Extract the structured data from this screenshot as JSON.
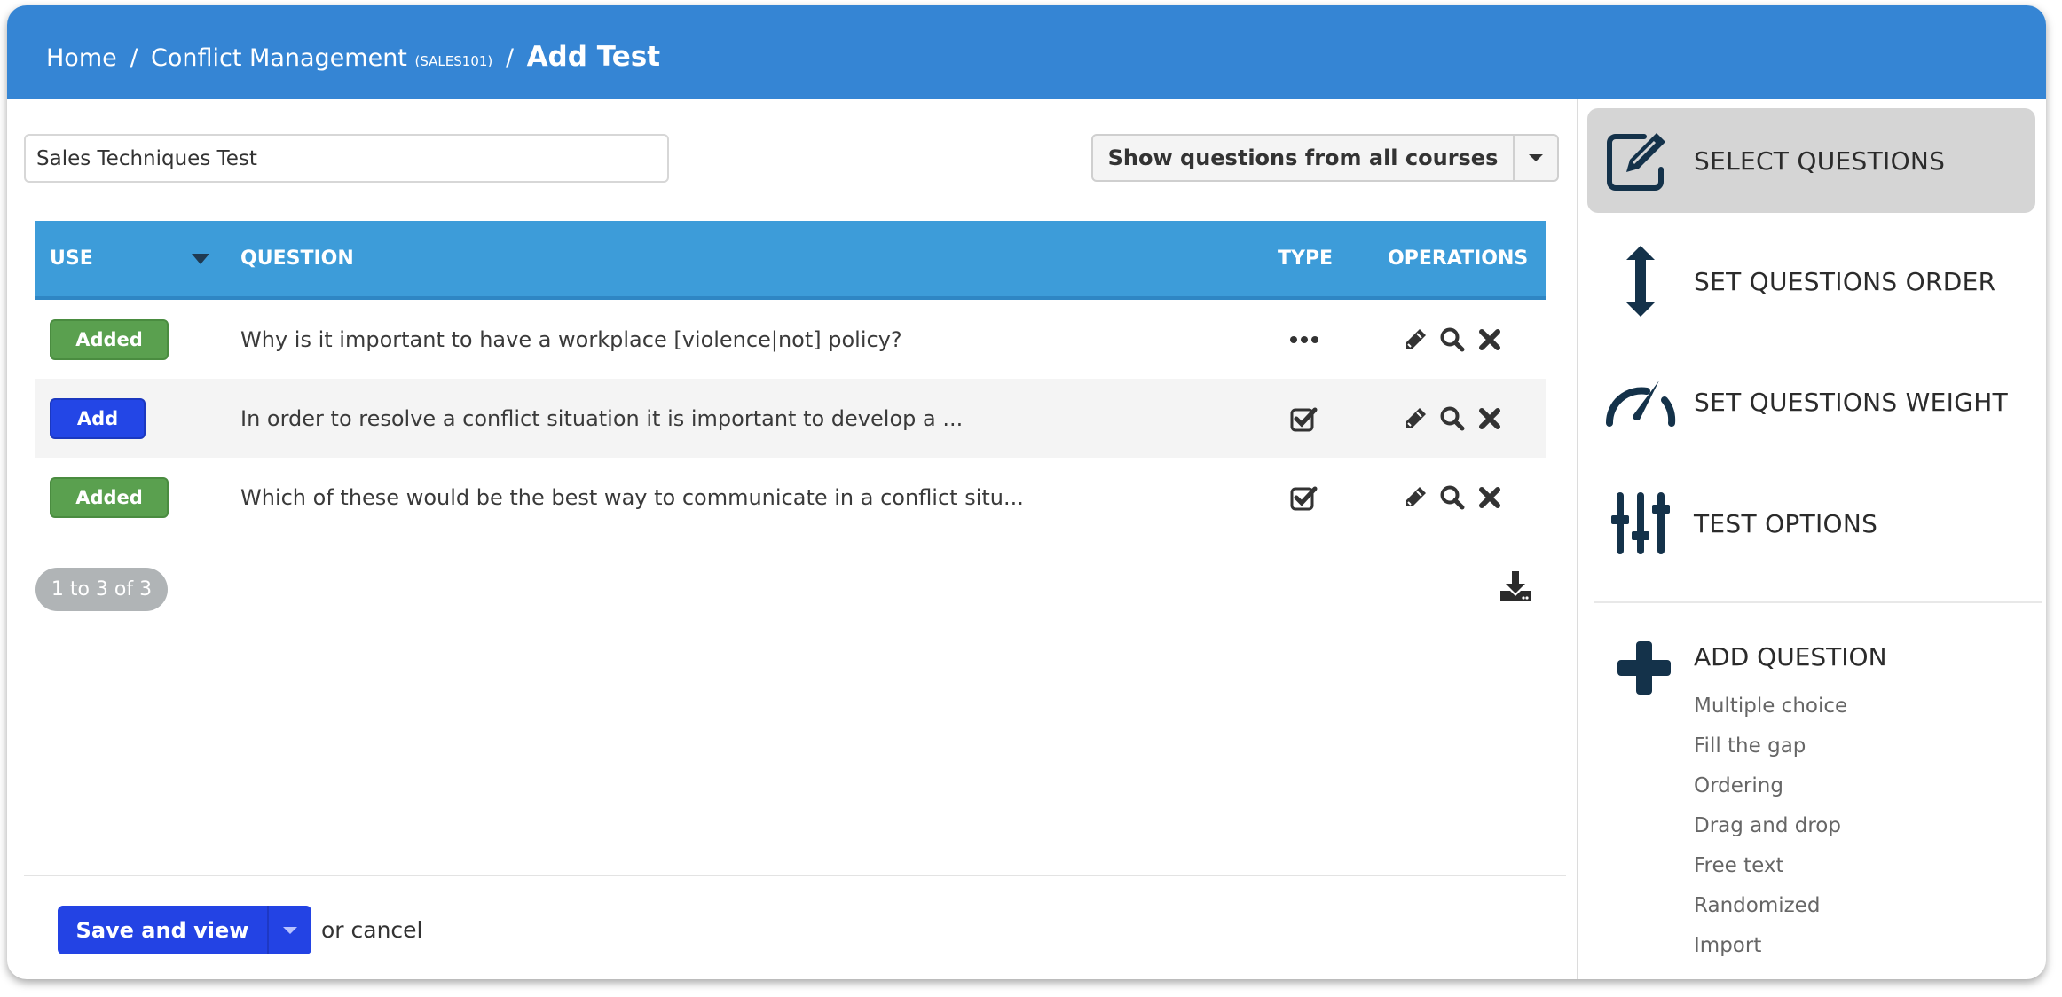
{
  "header": {
    "breadcrumb": {
      "home": "Home",
      "separator": "/",
      "course": "Conflict Management",
      "course_code": "(SALES101)",
      "current": "Add Test"
    }
  },
  "form": {
    "test_name_value": "Sales Techniques Test",
    "course_filter_label": "Show questions from all courses"
  },
  "table": {
    "columns": {
      "use": "USE",
      "question": "QUESTION",
      "type": "TYPE",
      "operations": "OPERATIONS"
    },
    "rows": [
      {
        "status": "Added",
        "question": "Why is it important to have a workplace [violence|not] policy?",
        "type_icon": "ellipsis-icon"
      },
      {
        "status": "Add",
        "question": "In order to resolve a conflict situation it is important to develop a ...",
        "type_icon": "checkbox-icon"
      },
      {
        "status": "Added",
        "question": "Which of these would be the best way to communicate in a conflict situ...",
        "type_icon": "checkbox-icon"
      }
    ],
    "operations_icons": [
      "pencil-icon",
      "search-icon",
      "close-icon"
    ],
    "pager": "1 to 3 of 3",
    "download_icon": "download-icon"
  },
  "footer": {
    "save_label": "Save and view",
    "cancel_text": "or cancel"
  },
  "sidebar": {
    "items": [
      {
        "label": "SELECT QUESTIONS",
        "icon": "edit-icon",
        "active": true
      },
      {
        "label": "SET QUESTIONS ORDER",
        "icon": "vertical-arrows-icon",
        "active": false
      },
      {
        "label": "SET QUESTIONS WEIGHT",
        "icon": "gauge-icon",
        "active": false
      },
      {
        "label": "TEST OPTIONS",
        "icon": "sliders-icon",
        "active": false
      }
    ],
    "add_question": {
      "title": "ADD QUESTION",
      "icon": "plus-icon",
      "types": [
        "Multiple choice",
        "Fill the gap",
        "Ordering",
        "Drag and drop",
        "Free text",
        "Randomized",
        "Import"
      ]
    }
  },
  "colors": {
    "header": "#3585d4",
    "table_header": "#3d9cd9",
    "added": "#5aa04f",
    "add": "#2346e6",
    "primary_button": "#2343e4",
    "sidebar_icon": "#14324a",
    "active_item_bg": "#d5d5d5"
  }
}
